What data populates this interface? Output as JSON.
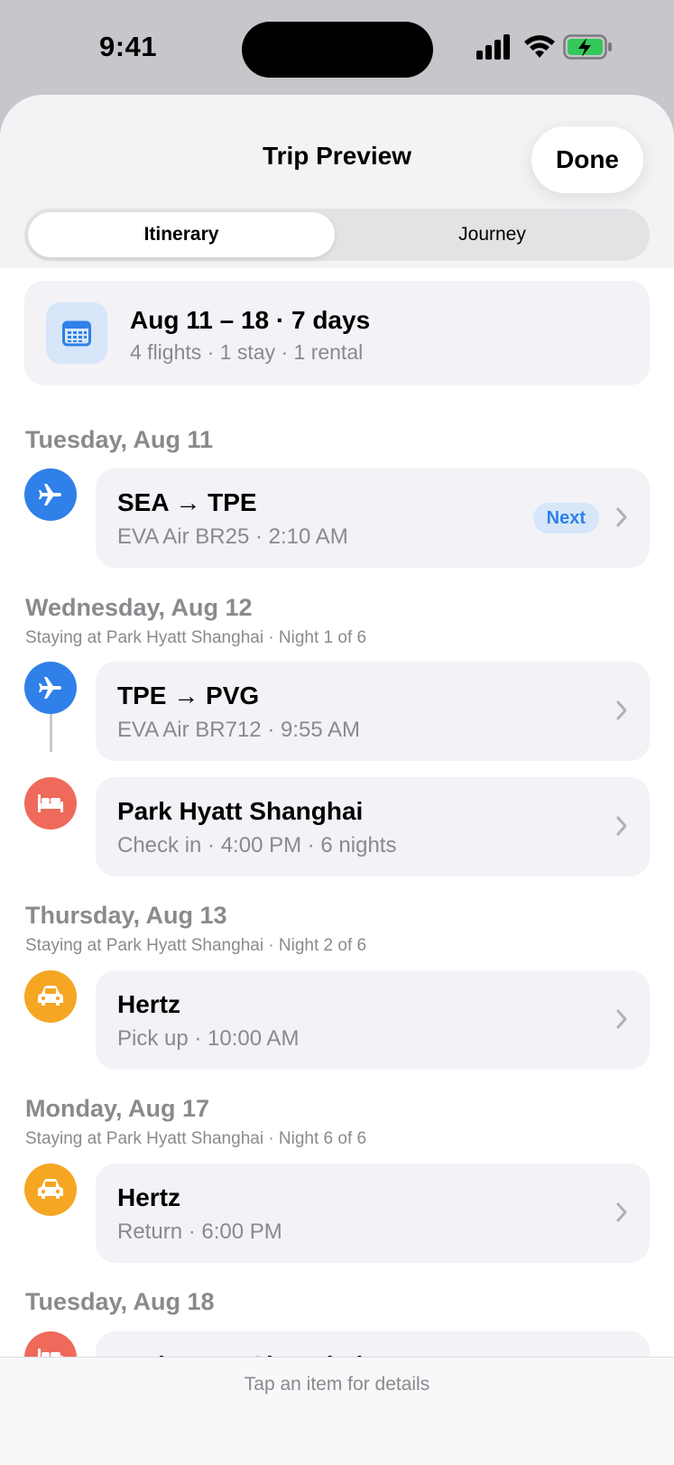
{
  "status_bar": {
    "time": "9:41"
  },
  "sheet": {
    "title": "Trip Preview",
    "done_label": "Done",
    "tabs": [
      {
        "label": "Itinerary",
        "selected": true
      },
      {
        "label": "Journey",
        "selected": false
      }
    ]
  },
  "summary": {
    "title": "Aug 11 – 18 · 7 days",
    "subtitle": "4 flights · 1 stay · 1 rental",
    "icon": "calendar-icon"
  },
  "days": [
    {
      "heading": "Tuesday, Aug 11",
      "items": [
        {
          "title": "SEA → TPE",
          "subtitle": "EVA Air BR25 · 2:10 AM",
          "badge": "Next",
          "icon": "airplane-icon"
        }
      ]
    },
    {
      "heading": "Wednesday, Aug 12",
      "subheading": "Staying at Park Hyatt Shanghai · Night 1 of 6",
      "items": [
        {
          "title": "TPE → PVG",
          "subtitle": "EVA Air BR712 · 9:55 AM",
          "icon": "airplane-icon"
        },
        {
          "title": "Park Hyatt Shanghai",
          "subtitle": "Check in · 4:00 PM · 6 nights",
          "icon": "bed-icon"
        }
      ]
    },
    {
      "heading": "Thursday, Aug 13",
      "subheading": "Staying at Park Hyatt Shanghai · Night 2 of 6",
      "items": [
        {
          "title": "Hertz",
          "subtitle": "Pick up · 10:00 AM",
          "icon": "car-icon"
        }
      ]
    },
    {
      "heading": "Monday, Aug 17",
      "subheading": "Staying at Park Hyatt Shanghai · Night 6 of 6",
      "items": [
        {
          "title": "Hertz",
          "subtitle": "Return · 6:00 PM",
          "icon": "car-icon"
        }
      ]
    },
    {
      "heading": "Tuesday, Aug 18",
      "items": [
        {
          "title": "Park Hyatt Shanghai",
          "icon": "bed-icon"
        }
      ]
    }
  ],
  "footer": {
    "hint": "Tap an item for details"
  },
  "colors": {
    "flight": "#2f80e8",
    "stay": "#ef6a5a",
    "rental": "#f5a623",
    "card_bg": "#f2f2f7",
    "secondary_text": "#8a8a8e"
  }
}
